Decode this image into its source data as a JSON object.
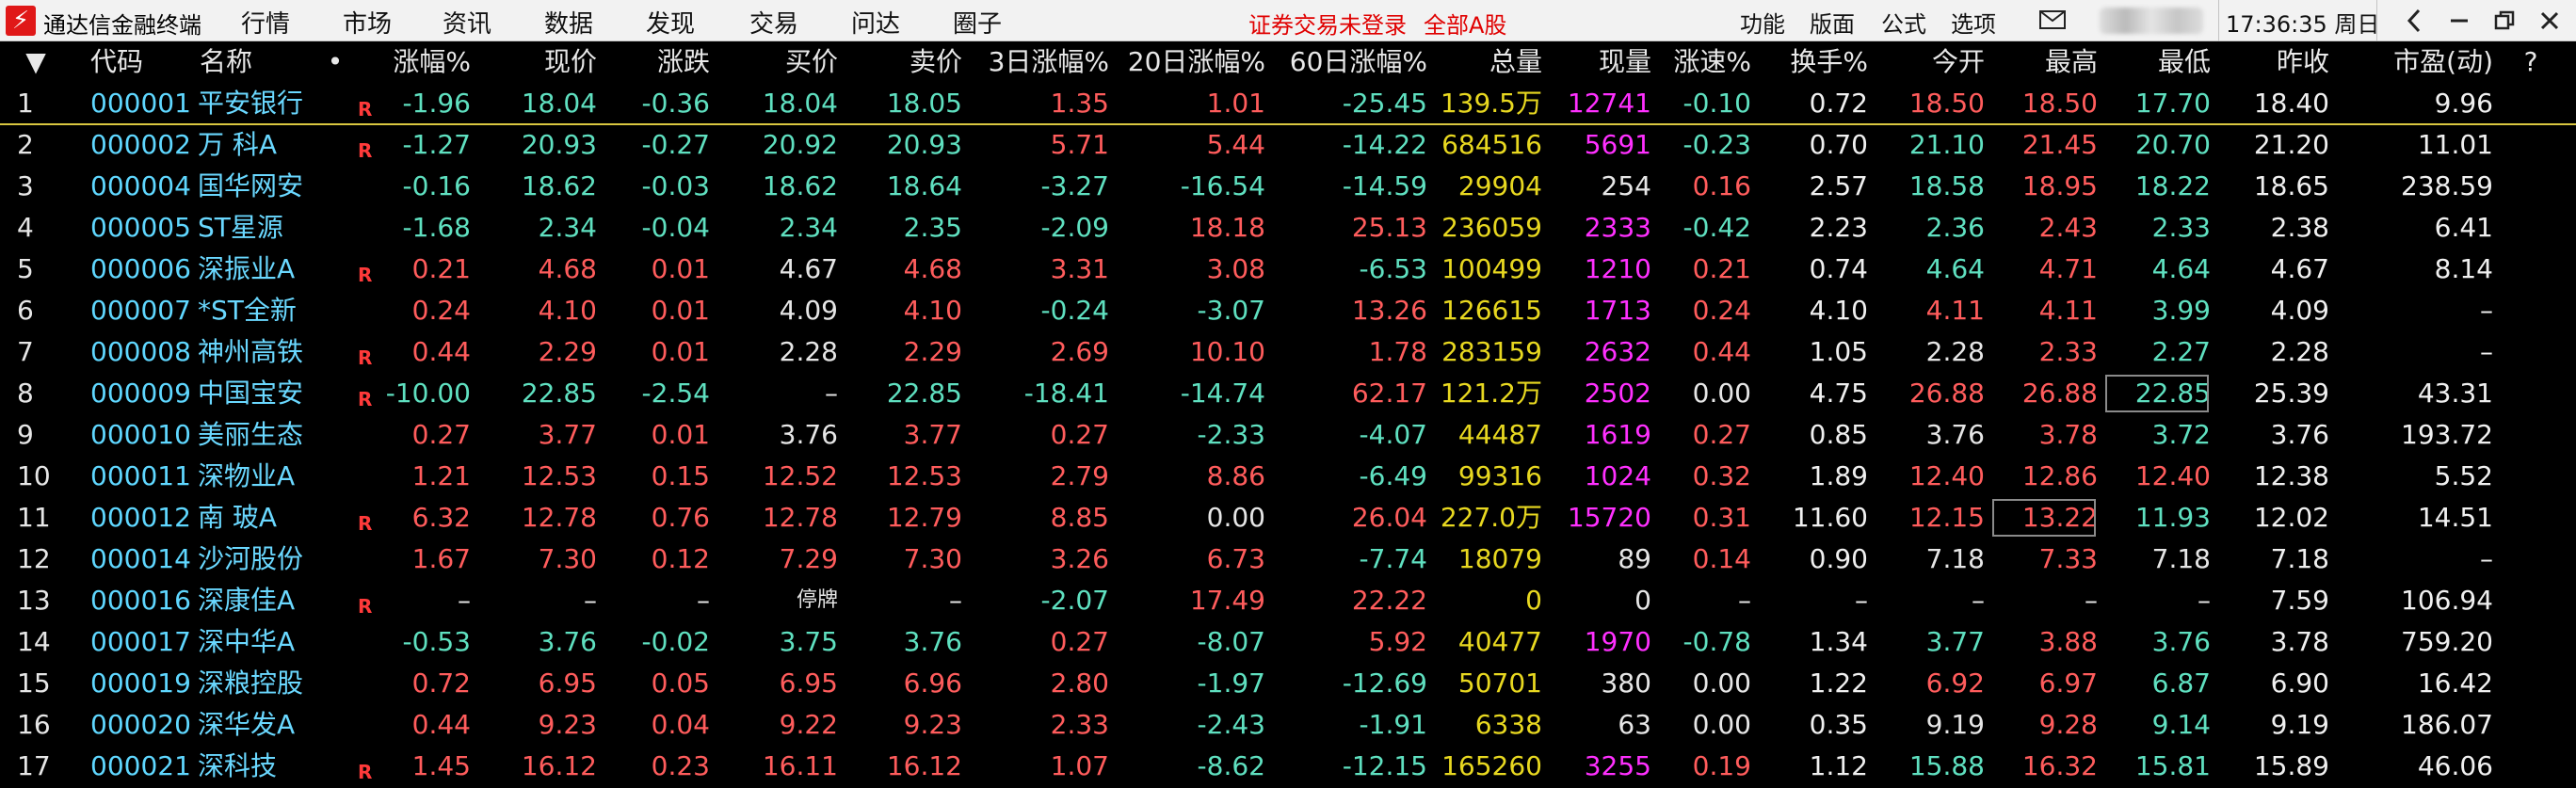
{
  "app": {
    "title": "通达信金融终端",
    "logo_glyph": "⚡",
    "brand_color": "#e01818"
  },
  "menu": [
    "行情",
    "市场",
    "资讯",
    "数据",
    "发现",
    "交易",
    "问达",
    "圈子"
  ],
  "status": {
    "not_logged_in": "证券交易未登录",
    "board": "全部A股"
  },
  "toolbar": [
    "功能",
    "版面",
    "公式",
    "选项"
  ],
  "clock": "17:36:35 周日",
  "table": {
    "headers": [
      "▼",
      "代码",
      "名称",
      "•",
      "涨幅%",
      "现价",
      "涨跌",
      "买价",
      "卖价",
      "3日涨幅%",
      "20日涨幅%",
      "60日涨幅%",
      "总量",
      "现量",
      "涨速%",
      "换手%",
      "今开",
      "最高",
      "最低",
      "昨收",
      "市盈(动)",
      "?"
    ],
    "rows": [
      {
        "idx": "1",
        "code": "000001",
        "name": "平安银行",
        "r": "R",
        "pct": "-1.96",
        "price": "18.04",
        "chg": "-0.36",
        "bid": "18.04",
        "ask": "18.05",
        "d3": "1.35",
        "d20": "1.01",
        "d60": "-25.45",
        "vol": "139.5万",
        "cur": "12741",
        "spd": "-0.10",
        "turn": "0.72",
        "open": "18.50",
        "high": "18.50",
        "low": "17.70",
        "prev": "18.40",
        "pe": "9.96"
      },
      {
        "idx": "2",
        "code": "000002",
        "name": "万 科A",
        "r": "R",
        "pct": "-1.27",
        "price": "20.93",
        "chg": "-0.27",
        "bid": "20.92",
        "ask": "20.93",
        "d3": "5.71",
        "d20": "5.44",
        "d60": "-14.22",
        "vol": "684516",
        "cur": "5691",
        "spd": "-0.23",
        "turn": "0.70",
        "open": "21.10",
        "high": "21.45",
        "low": "20.70",
        "prev": "21.20",
        "pe": "11.01"
      },
      {
        "idx": "3",
        "code": "000004",
        "name": "国华网安",
        "r": "",
        "pct": "-0.16",
        "price": "18.62",
        "chg": "-0.03",
        "bid": "18.62",
        "ask": "18.64",
        "d3": "-3.27",
        "d20": "-16.54",
        "d60": "-14.59",
        "vol": "29904",
        "cur": "254",
        "spd": "0.16",
        "turn": "2.57",
        "open": "18.58",
        "high": "18.95",
        "low": "18.22",
        "prev": "18.65",
        "pe": "238.59"
      },
      {
        "idx": "4",
        "code": "000005",
        "name": "ST星源",
        "r": "",
        "pct": "-1.68",
        "price": "2.34",
        "chg": "-0.04",
        "bid": "2.34",
        "ask": "2.35",
        "d3": "-2.09",
        "d20": "18.18",
        "d60": "25.13",
        "vol": "236059",
        "cur": "2333",
        "spd": "-0.42",
        "turn": "2.23",
        "open": "2.36",
        "high": "2.43",
        "low": "2.33",
        "prev": "2.38",
        "pe": "6.41"
      },
      {
        "idx": "5",
        "code": "000006",
        "name": "深振业A",
        "r": "R",
        "pct": "0.21",
        "price": "4.68",
        "chg": "0.01",
        "bid": "4.67",
        "ask": "4.68",
        "d3": "3.31",
        "d20": "3.08",
        "d60": "-6.53",
        "vol": "100499",
        "cur": "1210",
        "spd": "0.21",
        "turn": "0.74",
        "open": "4.64",
        "high": "4.71",
        "low": "4.64",
        "prev": "4.67",
        "pe": "8.14"
      },
      {
        "idx": "6",
        "code": "000007",
        "name": "*ST全新",
        "r": "",
        "pct": "0.24",
        "price": "4.10",
        "chg": "0.01",
        "bid": "4.09",
        "ask": "4.10",
        "d3": "-0.24",
        "d20": "-3.07",
        "d60": "13.26",
        "vol": "126615",
        "cur": "1713",
        "spd": "0.24",
        "turn": "4.10",
        "open": "4.11",
        "high": "4.11",
        "low": "3.99",
        "prev": "4.09",
        "pe": "–"
      },
      {
        "idx": "7",
        "code": "000008",
        "name": "神州高铁",
        "r": "R",
        "pct": "0.44",
        "price": "2.29",
        "chg": "0.01",
        "bid": "2.28",
        "ask": "2.29",
        "d3": "2.69",
        "d20": "10.10",
        "d60": "1.78",
        "vol": "283159",
        "cur": "2632",
        "spd": "0.44",
        "turn": "1.05",
        "open": "2.28",
        "high": "2.33",
        "low": "2.27",
        "prev": "2.28",
        "pe": "–"
      },
      {
        "idx": "8",
        "code": "000009",
        "name": "中国宝安",
        "r": "R",
        "pct": "-10.00",
        "price": "22.85",
        "chg": "-2.54",
        "bid": "–",
        "ask": "22.85",
        "d3": "-18.41",
        "d20": "-14.74",
        "d60": "62.17",
        "vol": "121.2万",
        "cur": "2502",
        "spd": "0.00",
        "turn": "4.75",
        "open": "26.88",
        "high": "26.88",
        "low": "22.85",
        "prev": "25.39",
        "pe": "43.31"
      },
      {
        "idx": "9",
        "code": "000010",
        "name": "美丽生态",
        "r": "",
        "pct": "0.27",
        "price": "3.77",
        "chg": "0.01",
        "bid": "3.76",
        "ask": "3.77",
        "d3": "0.27",
        "d20": "-2.33",
        "d60": "-4.07",
        "vol": "44487",
        "cur": "1619",
        "spd": "0.27",
        "turn": "0.85",
        "open": "3.76",
        "high": "3.78",
        "low": "3.72",
        "prev": "3.76",
        "pe": "193.72"
      },
      {
        "idx": "10",
        "code": "000011",
        "name": "深物业A",
        "r": "",
        "pct": "1.21",
        "price": "12.53",
        "chg": "0.15",
        "bid": "12.52",
        "ask": "12.53",
        "d3": "2.79",
        "d20": "8.86",
        "d60": "-6.49",
        "vol": "99316",
        "cur": "1024",
        "spd": "0.32",
        "turn": "1.89",
        "open": "12.40",
        "high": "12.86",
        "low": "12.40",
        "prev": "12.38",
        "pe": "5.52"
      },
      {
        "idx": "11",
        "code": "000012",
        "name": "南 玻A",
        "r": "R",
        "pct": "6.32",
        "price": "12.78",
        "chg": "0.76",
        "bid": "12.78",
        "ask": "12.79",
        "d3": "8.85",
        "d20": "0.00",
        "d60": "26.04",
        "vol": "227.0万",
        "cur": "15720",
        "spd": "0.31",
        "turn": "11.60",
        "open": "12.15",
        "high": "13.22",
        "low": "11.93",
        "prev": "12.02",
        "pe": "14.51"
      },
      {
        "idx": "12",
        "code": "000014",
        "name": "沙河股份",
        "r": "",
        "pct": "1.67",
        "price": "7.30",
        "chg": "0.12",
        "bid": "7.29",
        "ask": "7.30",
        "d3": "3.26",
        "d20": "6.73",
        "d60": "-7.74",
        "vol": "18079",
        "cur": "89",
        "spd": "0.14",
        "turn": "0.90",
        "open": "7.18",
        "high": "7.33",
        "low": "7.18",
        "prev": "7.18",
        "pe": "–"
      },
      {
        "idx": "13",
        "code": "000016",
        "name": "深康佳A",
        "r": "R",
        "pct": "–",
        "price": "–",
        "chg": "–",
        "bid": "停牌",
        "ask": "–",
        "d3": "-2.07",
        "d20": "17.49",
        "d60": "22.22",
        "vol": "0",
        "cur": "0",
        "spd": "–",
        "turn": "–",
        "open": "–",
        "high": "–",
        "low": "–",
        "prev": "7.59",
        "pe": "106.94"
      },
      {
        "idx": "14",
        "code": "000017",
        "name": "深中华A",
        "r": "",
        "pct": "-0.53",
        "price": "3.76",
        "chg": "-0.02",
        "bid": "3.75",
        "ask": "3.76",
        "d3": "0.27",
        "d20": "-8.07",
        "d60": "5.92",
        "vol": "40477",
        "cur": "1970",
        "spd": "-0.78",
        "turn": "1.34",
        "open": "3.77",
        "high": "3.88",
        "low": "3.76",
        "prev": "3.78",
        "pe": "759.20"
      },
      {
        "idx": "15",
        "code": "000019",
        "name": "深粮控股",
        "r": "",
        "pct": "0.72",
        "price": "6.95",
        "chg": "0.05",
        "bid": "6.95",
        "ask": "6.96",
        "d3": "2.80",
        "d20": "-1.97",
        "d60": "-12.69",
        "vol": "50701",
        "cur": "380",
        "spd": "0.00",
        "turn": "1.22",
        "open": "6.92",
        "high": "6.97",
        "low": "6.87",
        "prev": "6.90",
        "pe": "16.42"
      },
      {
        "idx": "16",
        "code": "000020",
        "name": "深华发A",
        "r": "",
        "pct": "0.44",
        "price": "9.23",
        "chg": "0.04",
        "bid": "9.22",
        "ask": "9.23",
        "d3": "2.33",
        "d20": "-2.43",
        "d60": "-1.91",
        "vol": "6338",
        "cur": "63",
        "spd": "0.00",
        "turn": "0.35",
        "open": "9.19",
        "high": "9.28",
        "low": "9.14",
        "prev": "9.19",
        "pe": "186.07"
      },
      {
        "idx": "17",
        "code": "000021",
        "name": "深科技",
        "r": "R",
        "pct": "1.45",
        "price": "16.12",
        "chg": "0.23",
        "bid": "16.11",
        "ask": "16.12",
        "d3": "1.07",
        "d20": "-8.62",
        "d60": "-12.15",
        "vol": "165260",
        "cur": "3255",
        "spd": "0.19",
        "turn": "1.12",
        "open": "15.88",
        "high": "16.32",
        "low": "15.81",
        "prev": "15.89",
        "pe": "46.06"
      }
    ]
  },
  "colors": {
    "up": "#ff5c5c",
    "down": "#5fe0c0",
    "neutral": "#e6e6e6",
    "code": "#5fd7ff",
    "volume": "#e8d820",
    "cur_volume": "#ff30ff"
  }
}
